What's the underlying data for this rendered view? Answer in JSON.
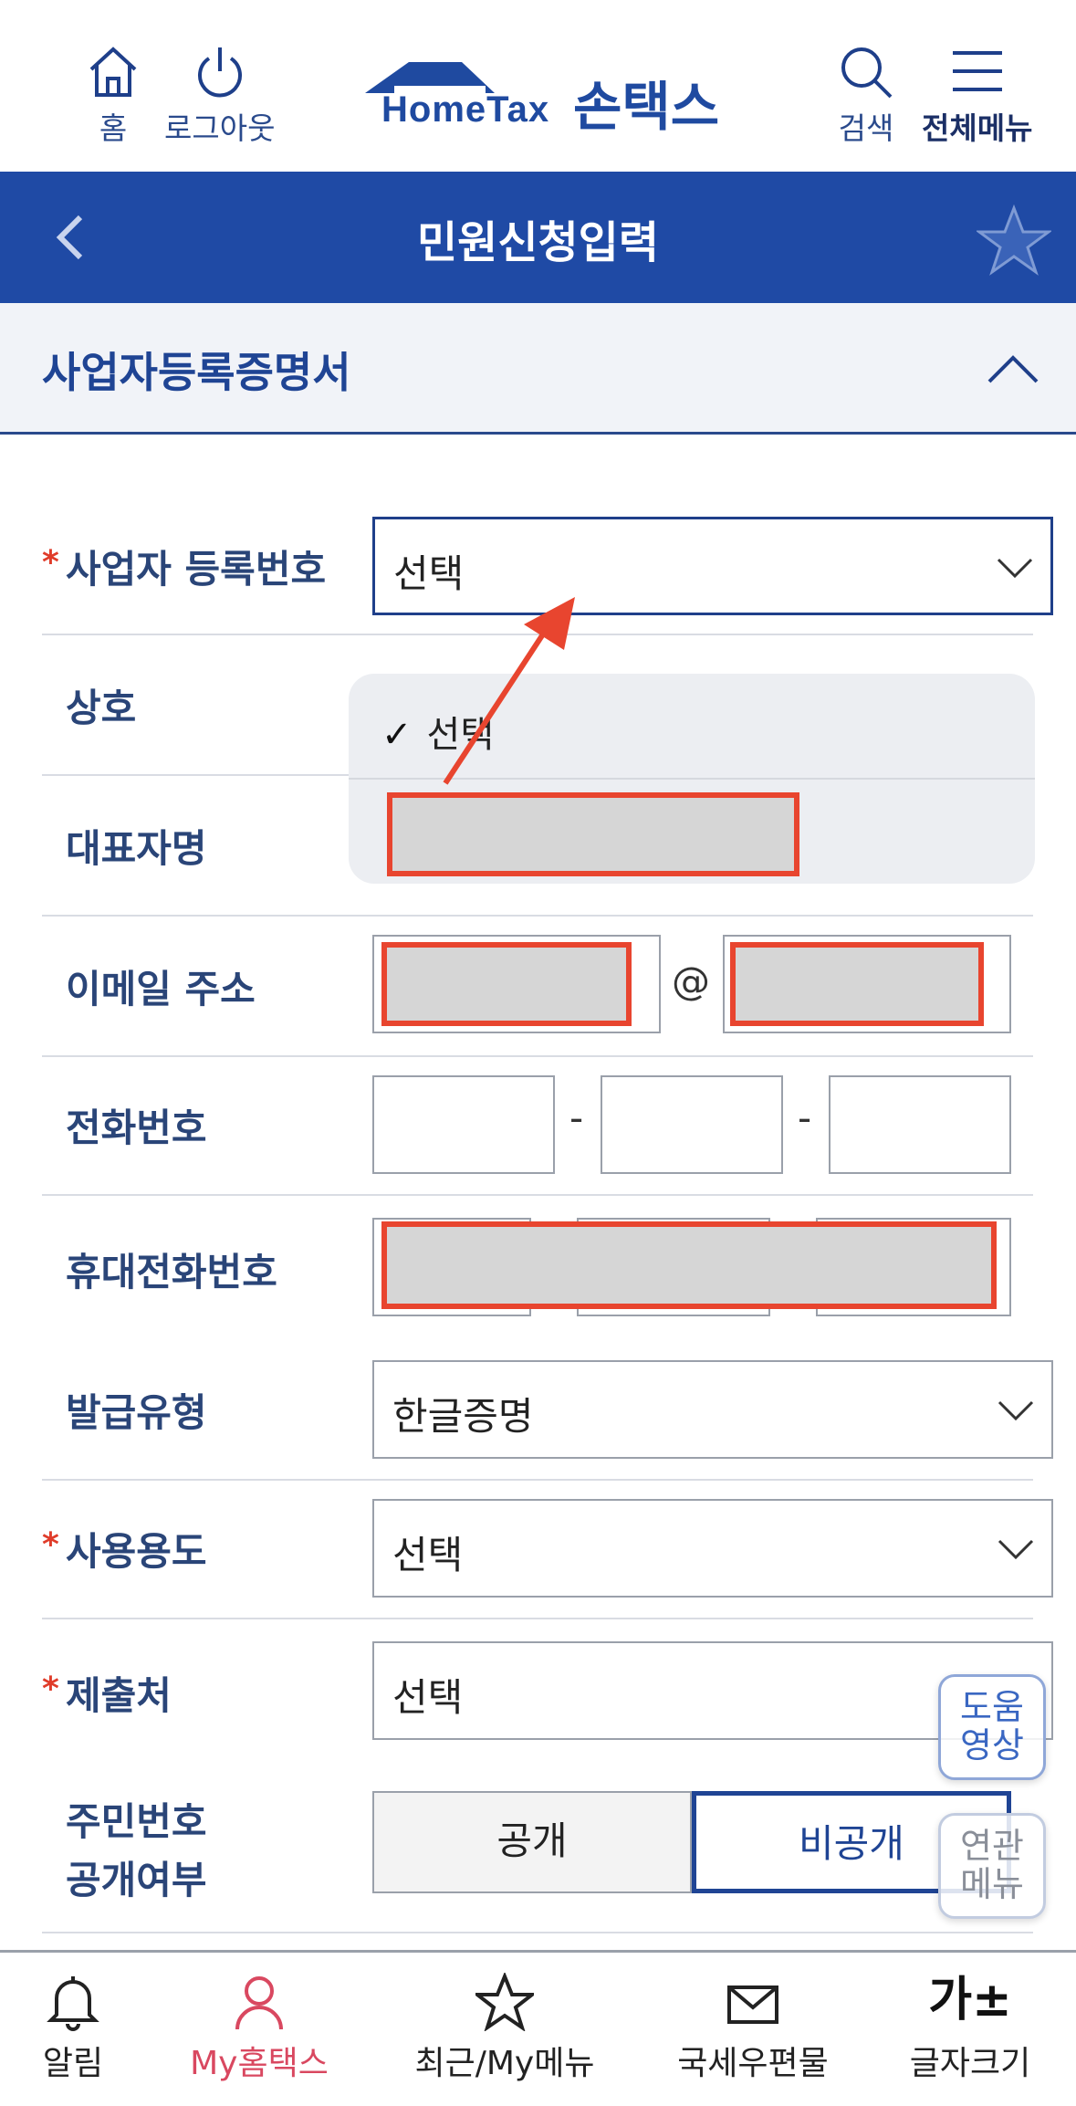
{
  "topbar": {
    "home_label": "홈",
    "logout_label": "로그아웃",
    "logo_en": "HomeTax",
    "logo_ko": "손택스",
    "search_label": "검색",
    "menu_label": "전체메뉴"
  },
  "titlebar": {
    "title": "민원신청입력"
  },
  "section": {
    "title": "사업자등록증명서"
  },
  "form": {
    "business_no_label": "사업자 등록번호",
    "business_no_value": "선택",
    "trade_name_label": "상호",
    "rep_name_label": "대표자명",
    "email_label": "이메일 주소",
    "email_at": "@",
    "phone_label": "전화번호",
    "phone_sep": "-",
    "mobile_label": "휴대전화번호",
    "issue_type_label": "발급유형",
    "issue_type_value": "한글증명",
    "purpose_label": "사용용도",
    "purpose_value": "선택",
    "submit_to_label": "제출처",
    "submit_to_value": "선택",
    "rrn_label_line1": "주민번호",
    "rrn_label_line2": "공개여부",
    "rrn_public": "공개",
    "rrn_private": "비공개",
    "required_mark": "*"
  },
  "dropdown": {
    "check": "✓",
    "option_selected": "선택"
  },
  "float": {
    "help_line1": "도움",
    "help_line2": "영상",
    "related_line1": "연관",
    "related_line2": "메뉴"
  },
  "bottomnav": {
    "alarm": "알림",
    "my_hometax": "My홈택스",
    "recent": "최근/My메뉴",
    "mail": "국세우편물",
    "font_size_glyph": "가±",
    "font_size": "글자크기"
  },
  "colors": {
    "brand": "#1f4aa5",
    "required": "#e03c2a",
    "active_nav": "#d94860",
    "annotation": "#e8452f"
  }
}
